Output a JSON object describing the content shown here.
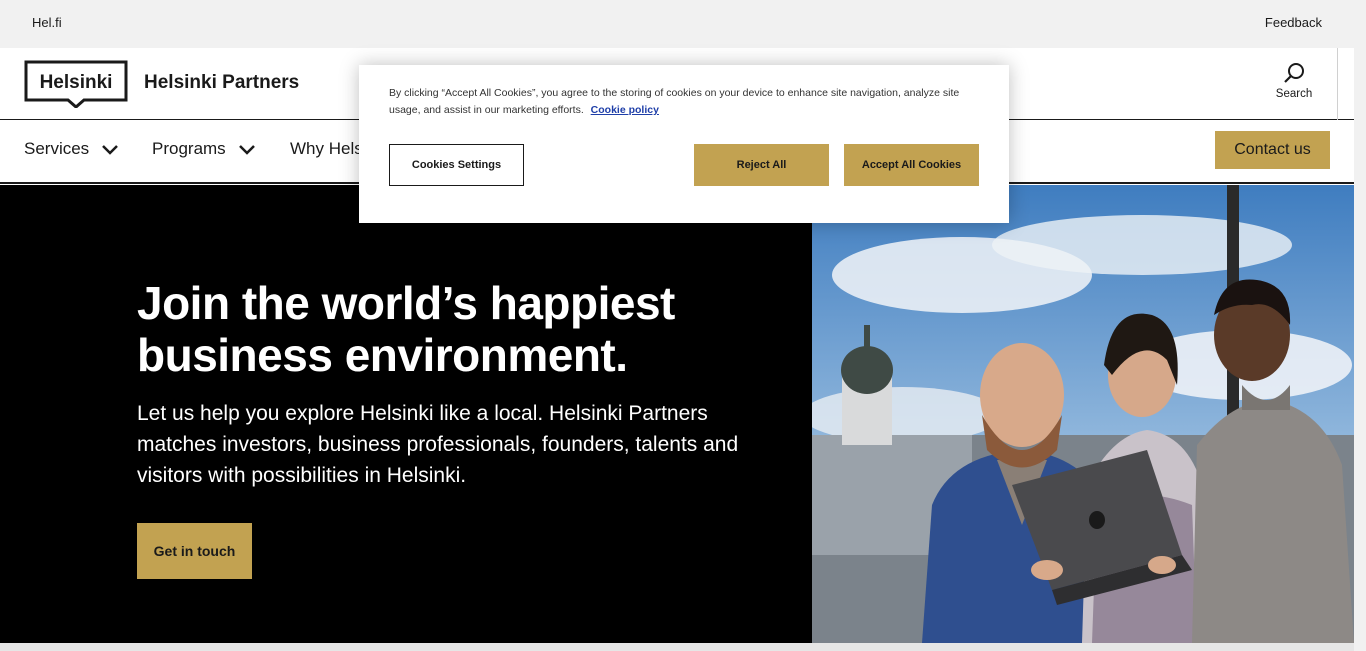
{
  "topbar": {
    "helfi": "Hel.fi",
    "feedback": "Feedback"
  },
  "header": {
    "logo_text": "Helsinki",
    "brand": "Helsinki Partners",
    "search_label": "Search"
  },
  "nav": {
    "items": [
      {
        "label": "Services"
      },
      {
        "label": "Programs"
      },
      {
        "label": "Why Hels"
      }
    ],
    "contact_label": "Contact us"
  },
  "hero": {
    "title_line1": "Join the world’s happiest",
    "title_line2": "business environment.",
    "description": "Let us help you explore Helsinki like a local. Helsinki Partners matches investors, business professionals, founders, talents and visitors with possibilities in Helsinki.",
    "cta_label": "Get in touch"
  },
  "cookie_banner": {
    "text": "By clicking “Accept All Cookies”, you agree to the storing of cookies on your device to enhance site navigation, analyze site usage, and assist in our marketing efforts.",
    "policy_link": "Cookie policy",
    "settings_label": "Cookies Settings",
    "reject_label": "Reject All",
    "accept_label": "Accept All Cookies"
  },
  "colors": {
    "accent": "#c2a251",
    "hero_bg": "#000000",
    "link": "#1e3ea8",
    "topbar_bg": "#f1f1f1"
  }
}
